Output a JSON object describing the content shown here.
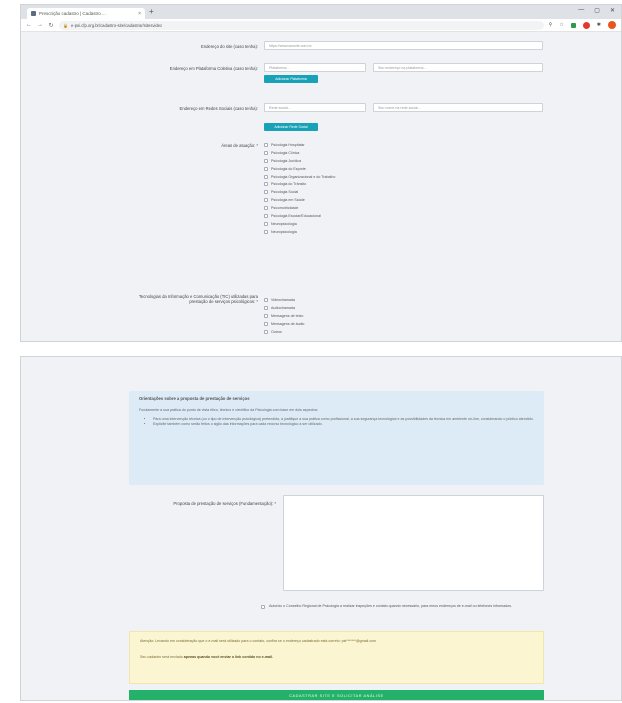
{
  "browser": {
    "tab_title": "Prescrição cadastro | Cadastro ...",
    "tab_close": "×",
    "new_tab": "+",
    "url": "e-psi.cfp.org.br/cadastro-site/cadastrar/sitesvideo",
    "controls": [
      "—",
      "▢",
      "✕"
    ]
  },
  "form1": {
    "site_label": "Endereço do site (caso tenha):",
    "site_placeholder": "https://www.seusite.com.br",
    "platform_label": "Endereço em Plataforma Coletiva (caso tenha):",
    "platform_name_placeholder": "Plataforma...",
    "platform_url_placeholder": "Seu endereço na plataforma...",
    "add_platform": "Adicionar Plataforma",
    "social_label": "Endereço em Redes Sociais (caso tenha):",
    "social_name_placeholder": "Rede social...",
    "social_url_placeholder": "Seu nome na rede social...",
    "add_social": "Adicionar Rede Social",
    "areas_label": "Áreas de atuação: *",
    "areas": [
      "Psicologia Hospitalar",
      "Psicologia Clínica",
      "Psicologia Jurídica",
      "Psicologia do Esporte",
      "Psicologia Organizacional e do Trabalho",
      "Psicologia do Trânsito",
      "Psicologia Social",
      "Psicologia em Saúde",
      "Psicomotricidade",
      "Psicologia Escolar/Educacional",
      "Neuropsicologia",
      "Neuropsicologia"
    ],
    "tic_label": "Tecnologias da Informação e Comunicação (TIC) utilizadas para prestação de serviços psicológicos: *",
    "tics": [
      "Videochamada",
      "Audiochamada",
      "Mensagens de texto",
      "Mensagens de áudio",
      "Outros"
    ]
  },
  "form2": {
    "info_title": "Orientações sobre a proposta de prestação de serviços",
    "info_intro": "Fundamente a sua prática do ponto de vista ético, técnico e científico da Psicologia com base em dois aspectos:",
    "info_items": [
      "Para uma intervenção técnica (ou o tipo de intervenção psicológica) pretendida, a justifique a sua prática como profissional, a sua segurança tecnológica e as possibilidades da técnica em ambiente on-line, considerando o público atendido.",
      "Explicite também como serão feitos o sigilo das informações para cada recurso tecnológico a ser utilizado."
    ],
    "proposal_label": "Proposta de prestação de serviços (Fundamentação): *",
    "accept_text": "Autorizo o Conselho Regional de Psicologia a realizar inspeções e contato quando necessário, para meus endereços de e-mail ou telefones informados.",
    "warn_line1": "Atenção: Levando em consideração que o e-mail será utilizado para o contato, confira se o endereço cadastrado está correto: psi*******@gmail.com",
    "warn_line2_prefix": "Seu cadastro será enviado",
    "warn_line2_bold": "apenas quando você enviar o link contido no e-mail.",
    "submit": "CADASTRAR SITE E SOLICITAR ANÁLISE"
  }
}
